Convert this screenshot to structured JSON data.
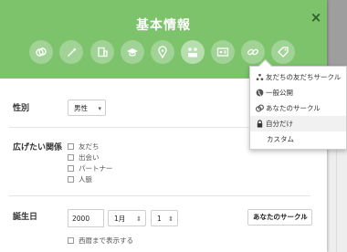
{
  "dialog": {
    "title": "基本情報",
    "close_label": "×"
  },
  "category_icons": [
    "rings-icon",
    "pen-icon",
    "building-icon",
    "graduation-cap-icon",
    "map-pin-icon",
    "network-icon",
    "id-card-icon",
    "link-icon",
    "tag-icon"
  ],
  "active_icon_index": 5,
  "gender": {
    "label": "性別",
    "value": "男性"
  },
  "interests": {
    "label": "広げたい関係",
    "options": [
      "友だち",
      "出会い",
      "パートナー",
      "人脈"
    ]
  },
  "birthday": {
    "label": "誕生日",
    "year": "2000",
    "month": "1月",
    "day": "1",
    "show_year_label": "西暦まで表示する",
    "visibility": "あなたのサークル"
  },
  "visibility_menu": {
    "items": [
      {
        "icon": "extended-circles-icon",
        "label": "友だちの友だちサークル"
      },
      {
        "icon": "globe-icon",
        "label": "一般公開"
      },
      {
        "icon": "circles-icon",
        "label": "あなたのサークル"
      },
      {
        "icon": "lock-icon",
        "label": "自分だけ"
      },
      {
        "icon": "",
        "label": "カスタム"
      }
    ],
    "selected_index": 3
  },
  "colors": {
    "header": "#7cc36c",
    "close": "#2f5f2a"
  }
}
